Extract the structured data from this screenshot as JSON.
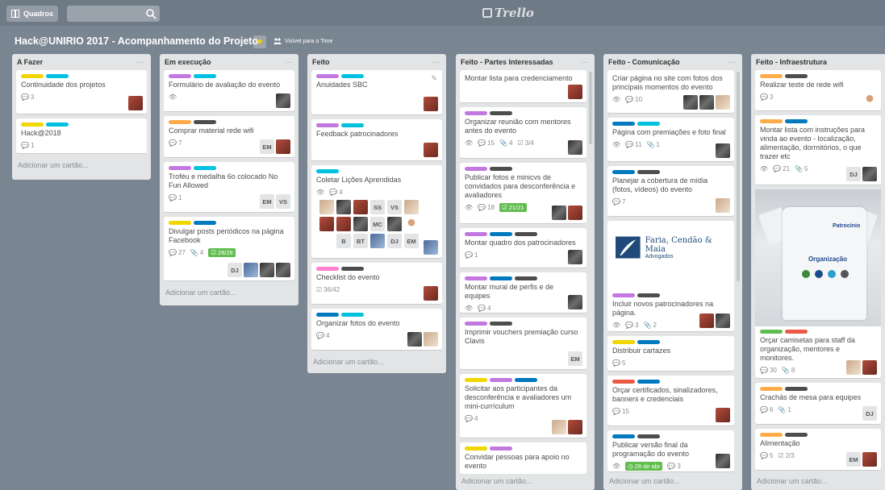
{
  "header": {
    "boards_label": "Quadros",
    "search_placeholder": "",
    "logo_text": "Trello"
  },
  "board": {
    "title": "Hack@UNIRIO 2017 - Acompanhamento do Projeto",
    "visibility": "Visível para o Time"
  },
  "colors": {
    "green": "#61bd4f",
    "yellow": "#f2d600",
    "orange": "#ffab4a",
    "red": "#eb5a46",
    "purple": "#c377e0",
    "blue": "#0079bf",
    "sky": "#00c2e0",
    "black": "#4d4d4d"
  },
  "add_card_label": "Adicionar um cartão...",
  "lists": [
    {
      "title": "A Fazer",
      "cards": [
        {
          "title": "Continuidade dos projetos",
          "comments": "3"
        },
        {
          "title": "Hack@2018",
          "comments": "1"
        }
      ]
    },
    {
      "title": "Em execução",
      "cards": [
        {
          "title": "Formulário de avaliação do evento"
        },
        {
          "title": "Comprar material rede wifi",
          "comments": "7",
          "members": [
            "EM"
          ]
        },
        {
          "title": "Troféu e medalha 6o colocado No Fun Allowed",
          "comments": "1",
          "members": [
            "EM",
            "VS"
          ]
        },
        {
          "title": "Divulgar posts periódicos na página Facebook",
          "comments": "27",
          "attachments": "4",
          "checklist": "28/28",
          "members": [
            "DJ"
          ]
        }
      ]
    },
    {
      "title": "Feito",
      "cards": [
        {
          "title": "Anuidades SBC"
        },
        {
          "title": "Feedback patrocinadores"
        },
        {
          "title": "Coletar Lições Aprendidas",
          "comments": "4",
          "members": [
            "SS",
            "VS",
            "MC",
            "B",
            "BT",
            "DJ",
            "EM"
          ]
        },
        {
          "title": "Checklist do evento",
          "checklist": "36/42"
        },
        {
          "title": "Organizar fotos do evento",
          "comments": "4"
        }
      ]
    },
    {
      "title": "Feito - Partes Interessadas",
      "cards": [
        {
          "title": "Montar lista para credenciamento"
        },
        {
          "title": "Organizar reunião com mentores antes do evento",
          "comments": "15",
          "attachments": "4",
          "checklist": "3/4"
        },
        {
          "title": "Publicar fotos e minicvs de convidados para desconferência e avaliadores",
          "comments": "18",
          "checklist": "21/21"
        },
        {
          "title": "Montar quadro dos patrocinadores",
          "comments": "1"
        },
        {
          "title": "Montar mural de perfis e de equipes",
          "comments": "4"
        },
        {
          "title": "Imprimir vouchers premiação curso Clavis",
          "members": [
            "EM"
          ]
        },
        {
          "title": "Solicitar aos participantes da desconferência e avaliadores um mini-currículum",
          "comments": "4"
        },
        {
          "title": "Convidar pessoas para apoio no evento"
        }
      ]
    },
    {
      "title": "Feito - Comunicação",
      "cards": [
        {
          "title": "Criar página no site com fotos dos principais momentos do evento",
          "comments": "10"
        },
        {
          "title": "Página com premiações e foto final",
          "comments": "11",
          "attachments": "1"
        },
        {
          "title": "Planejar a cobertura de mídia (fotos, vídeos) do evento",
          "comments": "7"
        },
        {
          "logo_name": "Faria, Cendão & Maia",
          "logo_sub": "Advogados"
        },
        {
          "title": "Incluir novos patrocinadores na página.",
          "comments": "3",
          "attachments": "2"
        },
        {
          "title": "Distribuir cartazes",
          "comments": "5"
        },
        {
          "title": "Orçar certificados, sinalizadores, banners e credenciais",
          "comments": "15"
        },
        {
          "title": "Publicar versão final da programação do evento",
          "due": "28 de abr",
          "comments": "3"
        }
      ]
    },
    {
      "title": "Feito - Infraestrutura",
      "cards": [
        {
          "title": "Realizar teste de rede wifi",
          "comments": "3"
        },
        {
          "title": "Montar lista com instruções para vinda ao evento - localização, alimentação, dormitórios, o que trazer etc",
          "comments": "21",
          "attachments": "5",
          "members": [
            "DJ"
          ]
        },
        {
          "title": "Orçar camisetas para staff da organização, mentores e monitores.",
          "comments": "30",
          "attachments": "8",
          "shirt_top": "Patrocínio",
          "shirt_mid": "Organização"
        },
        {
          "title": "Crachás de mesa para equipes",
          "comments": "6",
          "attachments": "1",
          "members": [
            "DJ"
          ]
        },
        {
          "title": "Alimentação",
          "comments": "5",
          "checklist": "2/3",
          "members": [
            "EM"
          ]
        }
      ]
    }
  ]
}
